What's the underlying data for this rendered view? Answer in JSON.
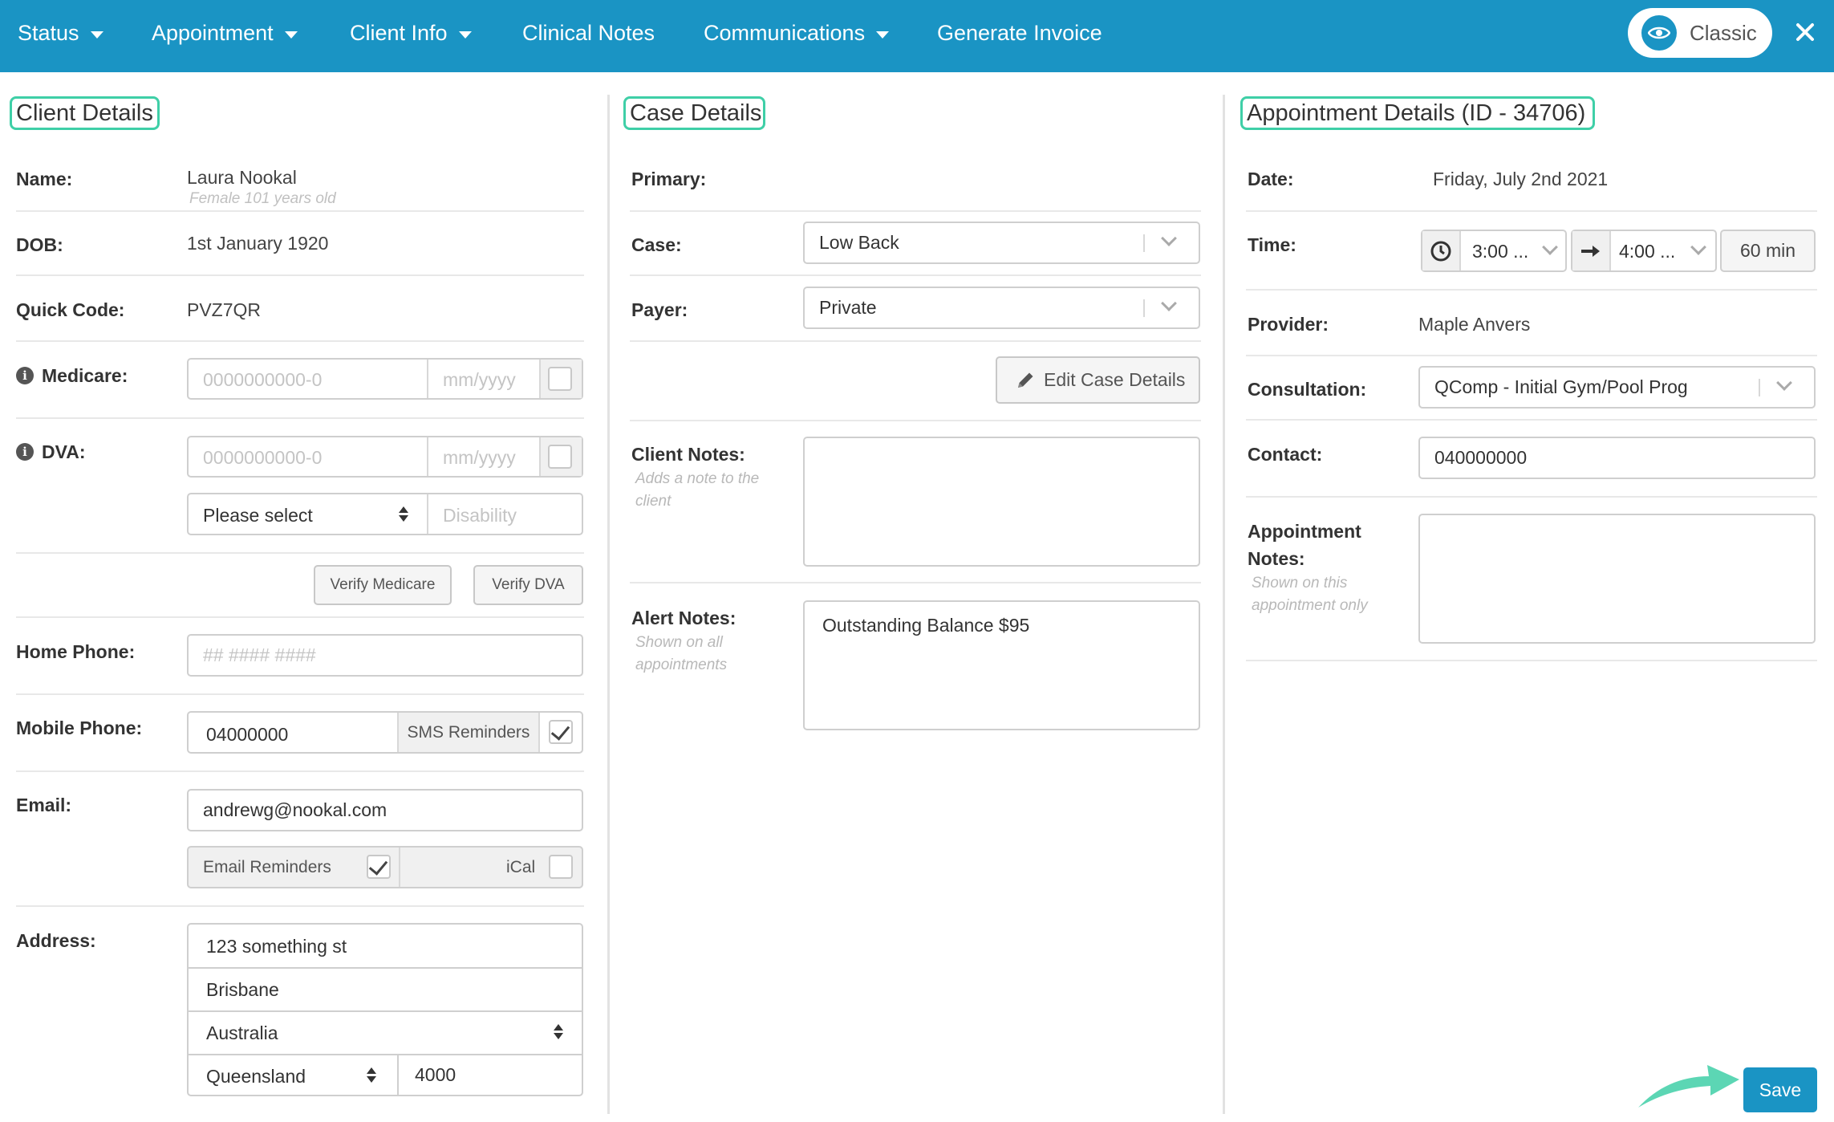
{
  "nav": {
    "status": "Status",
    "appointment": "Appointment",
    "client_info": "Client Info",
    "clinical_notes": "Clinical Notes",
    "communications": "Communications",
    "generate_invoice": "Generate Invoice",
    "classic": "Classic"
  },
  "client": {
    "title": "Client Details",
    "name_label": "Name:",
    "name": "Laura Nookal",
    "name_sub": "Female 101 years old",
    "dob_label": "DOB:",
    "dob": "1st January 1920",
    "quick_code_label": "Quick Code:",
    "quick_code": "PVZ7QR",
    "medicare_label": "Medicare:",
    "medicare_placeholder": "0000000000-0",
    "medicare_expiry_placeholder": "mm/yyyy",
    "dva_label": "DVA:",
    "dva_placeholder": "0000000000-0",
    "dva_expiry_placeholder": "mm/yyyy",
    "dva_select": "Please select",
    "disability_placeholder": "Disability",
    "verify_medicare": "Verify Medicare",
    "verify_dva": "Verify DVA",
    "home_phone_label": "Home Phone:",
    "home_phone_placeholder": "## #### ####",
    "mobile_label": "Mobile Phone:",
    "mobile": "04000000",
    "sms_reminders": "SMS Reminders",
    "email_label": "Email:",
    "email": "andrewg@nookal.com",
    "email_reminders": "Email Reminders",
    "ical": "iCal",
    "address_label": "Address:",
    "street": "123 something st",
    "city": "Brisbane",
    "country": "Australia",
    "state": "Queensland",
    "postcode": "4000"
  },
  "case": {
    "title": "Case Details",
    "primary_label": "Primary:",
    "case_label": "Case:",
    "case_value": "Low Back",
    "payer_label": "Payer:",
    "payer_value": "Private",
    "edit_button": "Edit Case Details",
    "client_notes_label": "Client Notes:",
    "client_notes_hint": "Adds a note to the client",
    "alert_notes_label": "Alert Notes:",
    "alert_notes_hint": "Shown on all appointments",
    "alert_notes_value": "Outstanding Balance $95"
  },
  "appointment": {
    "title": "Appointment Details (ID - 34706)",
    "date_label": "Date:",
    "date": "Friday, July 2nd 2021",
    "time_label": "Time:",
    "start_time": "3:00 ...",
    "end_time": "4:00 ...",
    "duration": "60 min",
    "provider_label": "Provider:",
    "provider": "Maple Anvers",
    "consultation_label": "Consultation:",
    "consultation": "QComp - Initial Gym/Pool Prog",
    "contact_label": "Contact:",
    "contact": "040000000",
    "notes_label_1": "Appointment",
    "notes_label_2": "Notes:",
    "notes_hint": "Shown on this appointment only",
    "save": "Save"
  },
  "colors": {
    "header": "#1a94c4",
    "accent": "#3fcfa7"
  }
}
